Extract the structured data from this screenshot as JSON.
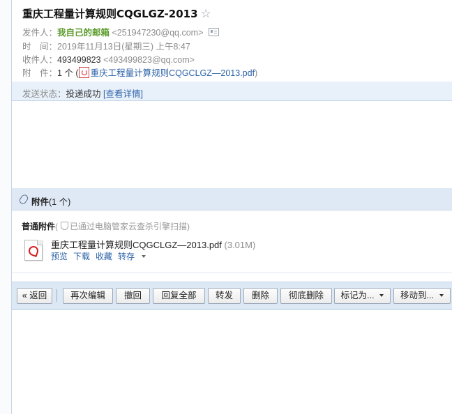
{
  "mail": {
    "subject": "重庆工程量计算规则CQGLGZ-2013",
    "star_icon": "☆",
    "sender_label": "发件人：",
    "sender_name": "我自己的邮箱",
    "sender_addr": "<251947230@qq.com>",
    "time_label": "时　间：",
    "time_value": "2019年11月13日(星期三) 上午8:47",
    "recipient_label": "收件人：",
    "recipient_name": "493499823",
    "recipient_addr": "<493499823@qq.com>",
    "attach_label": "附　件：",
    "attach_count": "1 个 (",
    "attach_file": "重庆工程量计算规则CQGCLGZ—2013.pdf",
    "attach_close": ")",
    "status_label": "发送状态：",
    "status_value": "投递成功",
    "status_link": "[查看详情]"
  },
  "attachments": {
    "title": "附件",
    "count": "(1 个)",
    "kind": "普通附件",
    "scan_note": "已通过电脑管家云查杀引擎扫描",
    "scan_open": "(",
    "scan_close": ")",
    "file_name": "重庆工程量计算规则CQGCLGZ—2013.pdf",
    "file_size": "(3.01M)",
    "ops": {
      "preview": "预览",
      "download": "下载",
      "collect": "收藏",
      "save": "转存"
    }
  },
  "toolbar": {
    "back": "« 返回",
    "reedit": "再次编辑",
    "recall": "撤回",
    "reply_all": "回复全部",
    "forward": "转发",
    "delete": "删除",
    "delete_forever": "彻底删除",
    "mark_as": "标记为...",
    "move_to": "移动到..."
  },
  "colors": {
    "sender": "#5b9b2a",
    "link": "#2c62a8",
    "toolbar_bg": "#dde8f5",
    "status_bg": "#e8f0fa"
  }
}
